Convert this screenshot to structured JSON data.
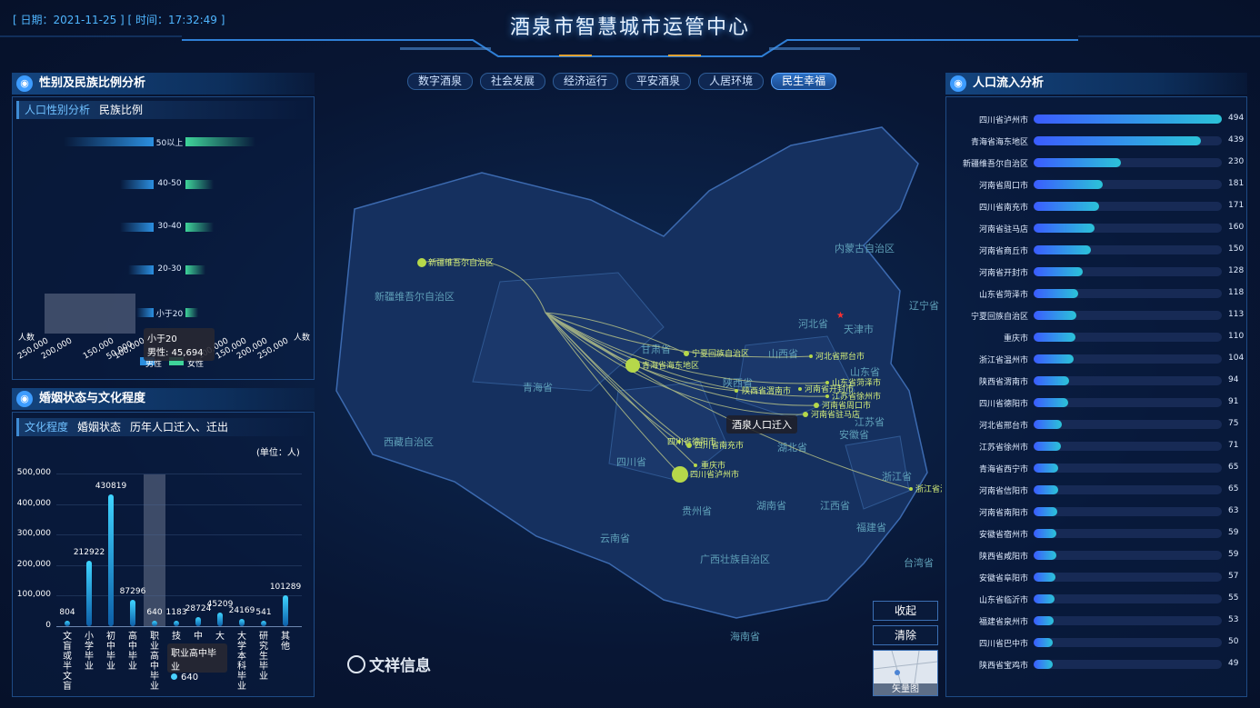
{
  "header": {
    "date_label": "[ 日期：2021-11-25 ] [ 时间：17:32:49 ]",
    "title": "酒泉市智慧城市运管中心"
  },
  "nav": {
    "tabs": [
      "数字酒泉",
      "社会发展",
      "经济运行",
      "平安酒泉",
      "人居环境",
      "民生幸福"
    ],
    "active": "民生幸福"
  },
  "left_top": {
    "title": "性别及民族比例分析",
    "subtabs": [
      "人口性别分析",
      "民族比例"
    ],
    "age_groups": [
      "50以上",
      "40-50",
      "30-40",
      "20-30",
      "小于20"
    ],
    "male_rel": [
      0.64,
      0.24,
      0.24,
      0.18,
      0.12
    ],
    "female_rel": [
      0.55,
      0.22,
      0.22,
      0.16,
      0.1
    ],
    "axis_left_label": "人数",
    "axis_right_label": "人数",
    "ticks_left": [
      "250,000",
      "200,000",
      "150,000",
      "100,000",
      "50,000"
    ],
    "ticks_right": [
      "100,000",
      "150,000",
      "200,000",
      "250,000"
    ],
    "legend": [
      "男性",
      "女性"
    ],
    "tooltip": {
      "group": "小于20",
      "value": "男性: 45,694"
    }
  },
  "left_bottom": {
    "title": "婚姻状态与文化程度",
    "subtabs": [
      "文化程度",
      "婚姻状态",
      "历年人口迁入、迁出"
    ],
    "unit": "(单位：人)",
    "y_ticks": [
      "500,000",
      "400,000",
      "300,000",
      "200,000",
      "100,000",
      "0"
    ],
    "tooltip": {
      "name": "职业高中毕业",
      "value": "640"
    }
  },
  "chart_data": {
    "type": "bar",
    "title": "文化程度",
    "ylabel": "(单位：人)",
    "ylim": [
      0,
      500000
    ],
    "categories": [
      "文盲或半文盲",
      "小学毕业",
      "初中毕业",
      "高中毕业",
      "职业高中毕业",
      "技工学校毕业",
      "中专毕业",
      "大专毕业",
      "大学本科毕业",
      "研究生毕业",
      "其他"
    ],
    "labels": [
      "文盲或半文盲",
      "小学毕业",
      "初中毕业",
      "高中毕业",
      "职业高中毕业",
      "技",
      "中",
      "大",
      "大学本科毕业",
      "研究生毕业",
      "其他"
    ],
    "values": [
      804,
      212922,
      430819,
      87296,
      640,
      1183,
      28724,
      45209,
      24169,
      541,
      101289
    ]
  },
  "map": {
    "origin_label": "酒泉人口迁入",
    "logo": "文祥信息",
    "buttons": {
      "collapse": "收起",
      "clear": "清除",
      "vector": "矢量图"
    },
    "provinces": [
      "新疆维吾尔自治区",
      "西藏自治区",
      "青海省",
      "甘肃省",
      "内蒙古自治区",
      "四川省",
      "云南省",
      "贵州省",
      "湖南省",
      "湖北省",
      "江西省",
      "安徽省",
      "江苏省",
      "山东省",
      "山西省",
      "陕西省",
      "河北省",
      "福建省",
      "浙江省",
      "广西壮族自治区",
      "辽宁省",
      "台湾省",
      "海南省",
      "天津市"
    ],
    "points": [
      "新疆维吾尔自治区",
      "宁夏回族自治区",
      "青海省海东地区",
      "河北省邢台市",
      "山东省菏泽市",
      "陕西省渭南市",
      "河南省开封市",
      "江苏省徐州市",
      "河南省周口市",
      "河南省驻马店",
      "四川省德阳市",
      "四川省南充市",
      "重庆市",
      "四川省泸州市",
      "浙江省温"
    ]
  },
  "right": {
    "title": "人口流入分析",
    "max": 494,
    "rows": [
      {
        "name": "四川省泸州市",
        "value": 494
      },
      {
        "name": "青海省海东地区",
        "value": 439
      },
      {
        "name": "新疆维吾尔自治区",
        "value": 230
      },
      {
        "name": "河南省周口市",
        "value": 181
      },
      {
        "name": "四川省南充市",
        "value": 171
      },
      {
        "name": "河南省驻马店",
        "value": 160
      },
      {
        "name": "河南省商丘市",
        "value": 150
      },
      {
        "name": "河南省开封市",
        "value": 128
      },
      {
        "name": "山东省菏泽市",
        "value": 118
      },
      {
        "name": "宁夏回族自治区",
        "value": 113
      },
      {
        "name": "重庆市",
        "value": 110
      },
      {
        "name": "浙江省温州市",
        "value": 104
      },
      {
        "name": "陕西省渭南市",
        "value": 94
      },
      {
        "name": "四川省德阳市",
        "value": 91
      },
      {
        "name": "河北省邢台市",
        "value": 75
      },
      {
        "name": "江苏省徐州市",
        "value": 71
      },
      {
        "name": "青海省西宁市",
        "value": 65
      },
      {
        "name": "河南省信阳市",
        "value": 65
      },
      {
        "name": "河南省南阳市",
        "value": 63
      },
      {
        "name": "安徽省宿州市",
        "value": 59
      },
      {
        "name": "陕西省咸阳市",
        "value": 59
      },
      {
        "name": "安徽省阜阳市",
        "value": 57
      },
      {
        "name": "山东省临沂市",
        "value": 55
      },
      {
        "name": "福建省泉州市",
        "value": 53
      },
      {
        "name": "四川省巴中市",
        "value": 50
      },
      {
        "name": "陕西省宝鸡市",
        "value": 49
      }
    ]
  }
}
